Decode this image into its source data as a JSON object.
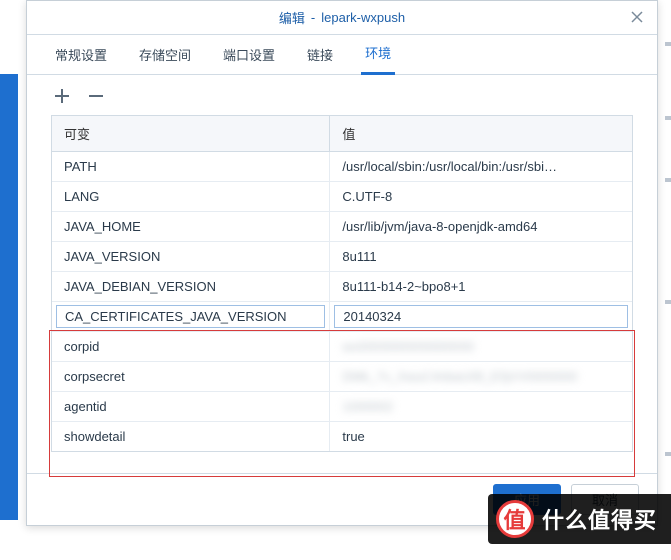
{
  "title_prefix": "编辑",
  "title_separator": "-",
  "title_name": "lepark-wxpush",
  "tabs": [
    {
      "label": "常规设置",
      "active": false
    },
    {
      "label": "存储空间",
      "active": false
    },
    {
      "label": "端口设置",
      "active": false
    },
    {
      "label": "链接",
      "active": false
    },
    {
      "label": "环境",
      "active": true
    }
  ],
  "table": {
    "header_key": "可变",
    "header_value": "值",
    "rows": [
      {
        "key": "PATH",
        "value": "/usr/local/sbin:/usr/local/bin:/usr/sbi…",
        "editing": false,
        "redacted": false
      },
      {
        "key": "LANG",
        "value": "C.UTF-8",
        "editing": false,
        "redacted": false
      },
      {
        "key": "JAVA_HOME",
        "value": "/usr/lib/jvm/java-8-openjdk-amd64",
        "editing": false,
        "redacted": false
      },
      {
        "key": "JAVA_VERSION",
        "value": "8u111",
        "editing": false,
        "redacted": false
      },
      {
        "key": "JAVA_DEBIAN_VERSION",
        "value": "8u111-b14-2~bpo8+1",
        "editing": false,
        "redacted": false
      },
      {
        "key": "CA_CERTIFICATES_JAVA_VERSION",
        "value": "20140324",
        "editing": true,
        "redacted": false
      },
      {
        "key": "corpid",
        "value": "wx0000000000000000",
        "editing": false,
        "redacted": true
      },
      {
        "key": "corpsecret",
        "value": "DMk_7v_XwuC4nbaU0ll_E5jVV0000000",
        "editing": false,
        "redacted": true
      },
      {
        "key": "agentid",
        "value": "1000002",
        "editing": false,
        "redacted": true
      },
      {
        "key": "showdetail",
        "value": "true",
        "editing": false,
        "redacted": false
      }
    ]
  },
  "highlight": {
    "start_row_index": 6,
    "end_row_index": 9
  },
  "footer": {
    "apply": "应用",
    "cancel": "取消"
  },
  "watermark": {
    "badge": "值",
    "text": "什么值得买"
  },
  "colors": {
    "accent": "#1e6fcf",
    "danger": "#d63b3b"
  }
}
